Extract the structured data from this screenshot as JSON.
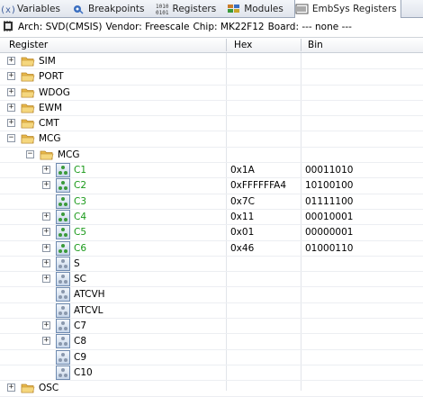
{
  "tabs": [
    {
      "label": "Variables",
      "icon": "variables-icon"
    },
    {
      "label": "Breakpoints",
      "icon": "breakpoints-icon"
    },
    {
      "label": "Registers",
      "icon": "registers-icon"
    },
    {
      "label": "Modules",
      "icon": "modules-icon"
    },
    {
      "label": "EmbSys Registers",
      "icon": "embsys-registers-icon",
      "active": true
    }
  ],
  "info": {
    "arch": "Arch: SVD(CMSIS)",
    "vendor": "Vendor: Freescale",
    "chip": "Chip: MK22F12",
    "board": "Board: ---  none ---"
  },
  "columns": {
    "register": "Register",
    "hex": "Hex",
    "bin": "Bin"
  },
  "rows": [
    {
      "depth": 0,
      "kind": "group",
      "expander": "+",
      "label": "SIM",
      "hex": "",
      "bin": ""
    },
    {
      "depth": 0,
      "kind": "group",
      "expander": "+",
      "label": "PORT",
      "hex": "",
      "bin": ""
    },
    {
      "depth": 0,
      "kind": "group",
      "expander": "+",
      "label": "WDOG",
      "hex": "",
      "bin": ""
    },
    {
      "depth": 0,
      "kind": "group",
      "expander": "+",
      "label": "EWM",
      "hex": "",
      "bin": ""
    },
    {
      "depth": 0,
      "kind": "group",
      "expander": "+",
      "label": "CMT",
      "hex": "",
      "bin": ""
    },
    {
      "depth": 0,
      "kind": "group",
      "expander": "-",
      "label": "MCG",
      "hex": "",
      "bin": ""
    },
    {
      "depth": 1,
      "kind": "group",
      "expander": "-",
      "label": "MCG",
      "hex": "",
      "bin": ""
    },
    {
      "depth": 2,
      "kind": "reg",
      "active": true,
      "expander": "+",
      "label": "C1",
      "hex": "0x1A",
      "bin": "00011010"
    },
    {
      "depth": 2,
      "kind": "reg",
      "active": true,
      "expander": "+",
      "label": "C2",
      "hex": "0xFFFFFFA4",
      "bin": "10100100"
    },
    {
      "depth": 2,
      "kind": "reg",
      "active": true,
      "expander": "",
      "label": "C3",
      "hex": "0x7C",
      "bin": "01111100"
    },
    {
      "depth": 2,
      "kind": "reg",
      "active": true,
      "expander": "+",
      "label": "C4",
      "hex": "0x11",
      "bin": "00010001"
    },
    {
      "depth": 2,
      "kind": "reg",
      "active": true,
      "expander": "+",
      "label": "C5",
      "hex": "0x01",
      "bin": "00000001"
    },
    {
      "depth": 2,
      "kind": "reg",
      "active": true,
      "expander": "+",
      "label": "C6",
      "hex": "0x46",
      "bin": "01000110"
    },
    {
      "depth": 2,
      "kind": "reg",
      "active": false,
      "expander": "+",
      "label": "S",
      "hex": "",
      "bin": ""
    },
    {
      "depth": 2,
      "kind": "reg",
      "active": false,
      "expander": "+",
      "label": "SC",
      "hex": "",
      "bin": ""
    },
    {
      "depth": 2,
      "kind": "reg",
      "active": false,
      "expander": "",
      "label": "ATCVH",
      "hex": "",
      "bin": ""
    },
    {
      "depth": 2,
      "kind": "reg",
      "active": false,
      "expander": "",
      "label": "ATCVL",
      "hex": "",
      "bin": ""
    },
    {
      "depth": 2,
      "kind": "reg",
      "active": false,
      "expander": "+",
      "label": "C7",
      "hex": "",
      "bin": ""
    },
    {
      "depth": 2,
      "kind": "reg",
      "active": false,
      "expander": "+",
      "label": "C8",
      "hex": "",
      "bin": ""
    },
    {
      "depth": 2,
      "kind": "reg",
      "active": false,
      "expander": "",
      "label": "C9",
      "hex": "",
      "bin": ""
    },
    {
      "depth": 2,
      "kind": "reg",
      "active": false,
      "expander": "",
      "label": "C10",
      "hex": "",
      "bin": ""
    },
    {
      "depth": 0,
      "kind": "group",
      "expander": "+",
      "label": "OSC",
      "hex": "",
      "bin": ""
    }
  ],
  "colors": {
    "active_register": "#1a9a1a",
    "folder": "#e8b84a",
    "chip_icon": "#3a9a3a"
  }
}
